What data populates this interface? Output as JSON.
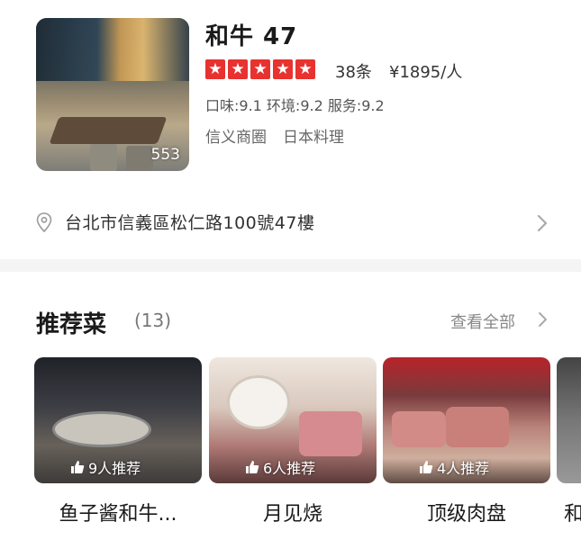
{
  "shop": {
    "name": "和牛 47",
    "photo_count": "553",
    "star_glyph": "★",
    "reviews": "38条",
    "price": "¥1895/人",
    "scores": "口味:9.1 环境:9.2 服务:9.2",
    "area": "信义商圈",
    "cuisine": "日本料理",
    "address": "台北市信義區松仁路100號47樓"
  },
  "recommended": {
    "title": "推荐菜",
    "count": "(13)",
    "see_all": "查看全部",
    "dishes": [
      {
        "name": "鱼子酱和牛...",
        "recs": "9人推荐"
      },
      {
        "name": "月见烧",
        "recs": "6人推荐"
      },
      {
        "name": "顶级肉盘",
        "recs": "4人推荐"
      },
      {
        "name": "和"
      }
    ]
  },
  "colors": {
    "star_red": "#e8322f",
    "divider_gray": "#f4f4f4"
  }
}
